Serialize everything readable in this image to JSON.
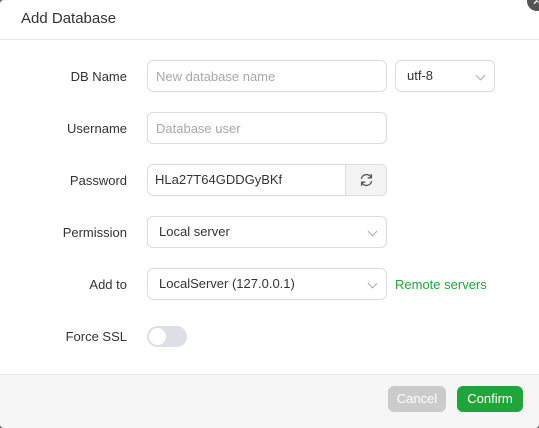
{
  "dialog": {
    "title": "Add Database"
  },
  "form": {
    "db_name": {
      "label": "DB Name",
      "value": "",
      "placeholder": "New database name"
    },
    "charset": {
      "value": "utf-8"
    },
    "username": {
      "label": "Username",
      "value": "",
      "placeholder": "Database user"
    },
    "password": {
      "label": "Password",
      "value": "HLa27T64GDDGyBKf"
    },
    "permission": {
      "label": "Permission",
      "value": "Local server"
    },
    "add_to": {
      "label": "Add to",
      "value": "LocalServer (127.0.0.1)",
      "link": "Remote servers"
    },
    "force_ssl": {
      "label": "Force SSL",
      "enabled": false
    }
  },
  "footer": {
    "cancel_label": "Cancel",
    "confirm_label": "Confirm"
  },
  "colors": {
    "accent": "#20a53a",
    "cancel_bg": "#cbcbcb"
  },
  "icons": {
    "close": "close-icon",
    "refresh": "refresh-icon",
    "chevron": "chevron-down-icon"
  }
}
